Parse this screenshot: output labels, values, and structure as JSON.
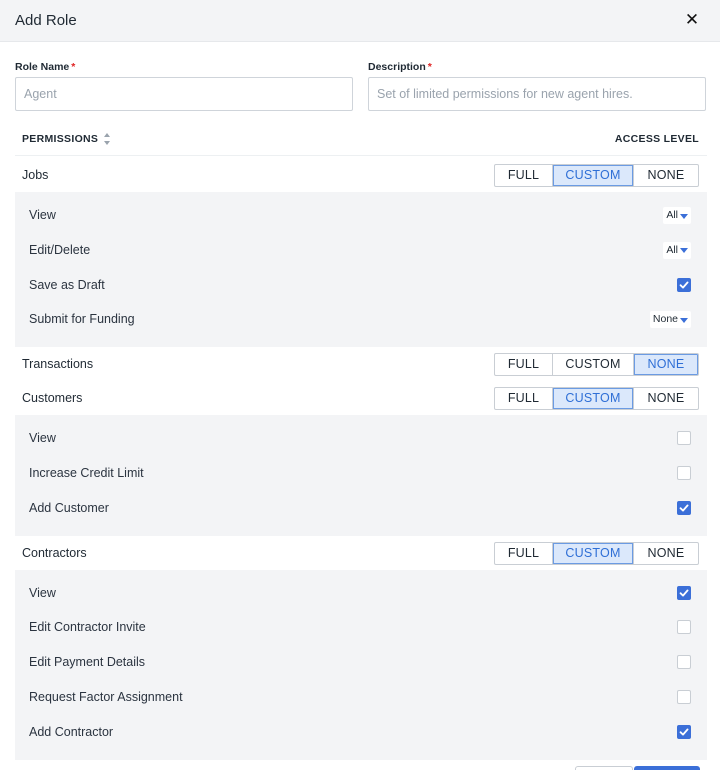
{
  "modal": {
    "title": "Add Role"
  },
  "form": {
    "role_name": {
      "label": "Role Name",
      "required_mark": "*",
      "placeholder": "Agent",
      "value": ""
    },
    "description": {
      "label": "Description",
      "required_mark": "*",
      "placeholder": "Set of limited permissions for new agent hires.",
      "value": ""
    }
  },
  "permissions_header": {
    "left": "PERMISSIONS",
    "right": "ACCESS LEVEL"
  },
  "access_options": [
    "FULL",
    "CUSTOM",
    "NONE"
  ],
  "colors": {
    "accent": "#3b6fd8",
    "active_bg": "#dbe8fb",
    "panel_bg": "#f3f4f6",
    "required": "#e02424"
  },
  "categories": [
    {
      "label": "Jobs",
      "selected": "CUSTOM",
      "items": [
        {
          "label": "View",
          "control": "select",
          "value": "All"
        },
        {
          "label": "Edit/Delete",
          "control": "select",
          "value": "All"
        },
        {
          "label": "Save as Draft",
          "control": "checkbox",
          "checked": true
        },
        {
          "label": "Submit for Funding",
          "control": "select",
          "value": "None"
        }
      ]
    },
    {
      "label": "Transactions",
      "selected": "NONE",
      "items": []
    },
    {
      "label": "Customers",
      "selected": "CUSTOM",
      "items": [
        {
          "label": "View",
          "control": "checkbox",
          "checked": false
        },
        {
          "label": "Increase Credit Limit",
          "control": "checkbox",
          "checked": false
        },
        {
          "label": "Add Customer",
          "control": "checkbox",
          "checked": true
        }
      ]
    },
    {
      "label": "Contractors",
      "selected": "CUSTOM",
      "items": [
        {
          "label": "View",
          "control": "checkbox",
          "checked": true
        },
        {
          "label": "Edit Contractor Invite",
          "control": "checkbox",
          "checked": false
        },
        {
          "label": "Edit Payment Details",
          "control": "checkbox",
          "checked": false
        },
        {
          "label": "Request Factor Assignment",
          "control": "checkbox",
          "checked": false
        },
        {
          "label": "Add Contractor",
          "control": "checkbox",
          "checked": true
        }
      ]
    }
  ]
}
